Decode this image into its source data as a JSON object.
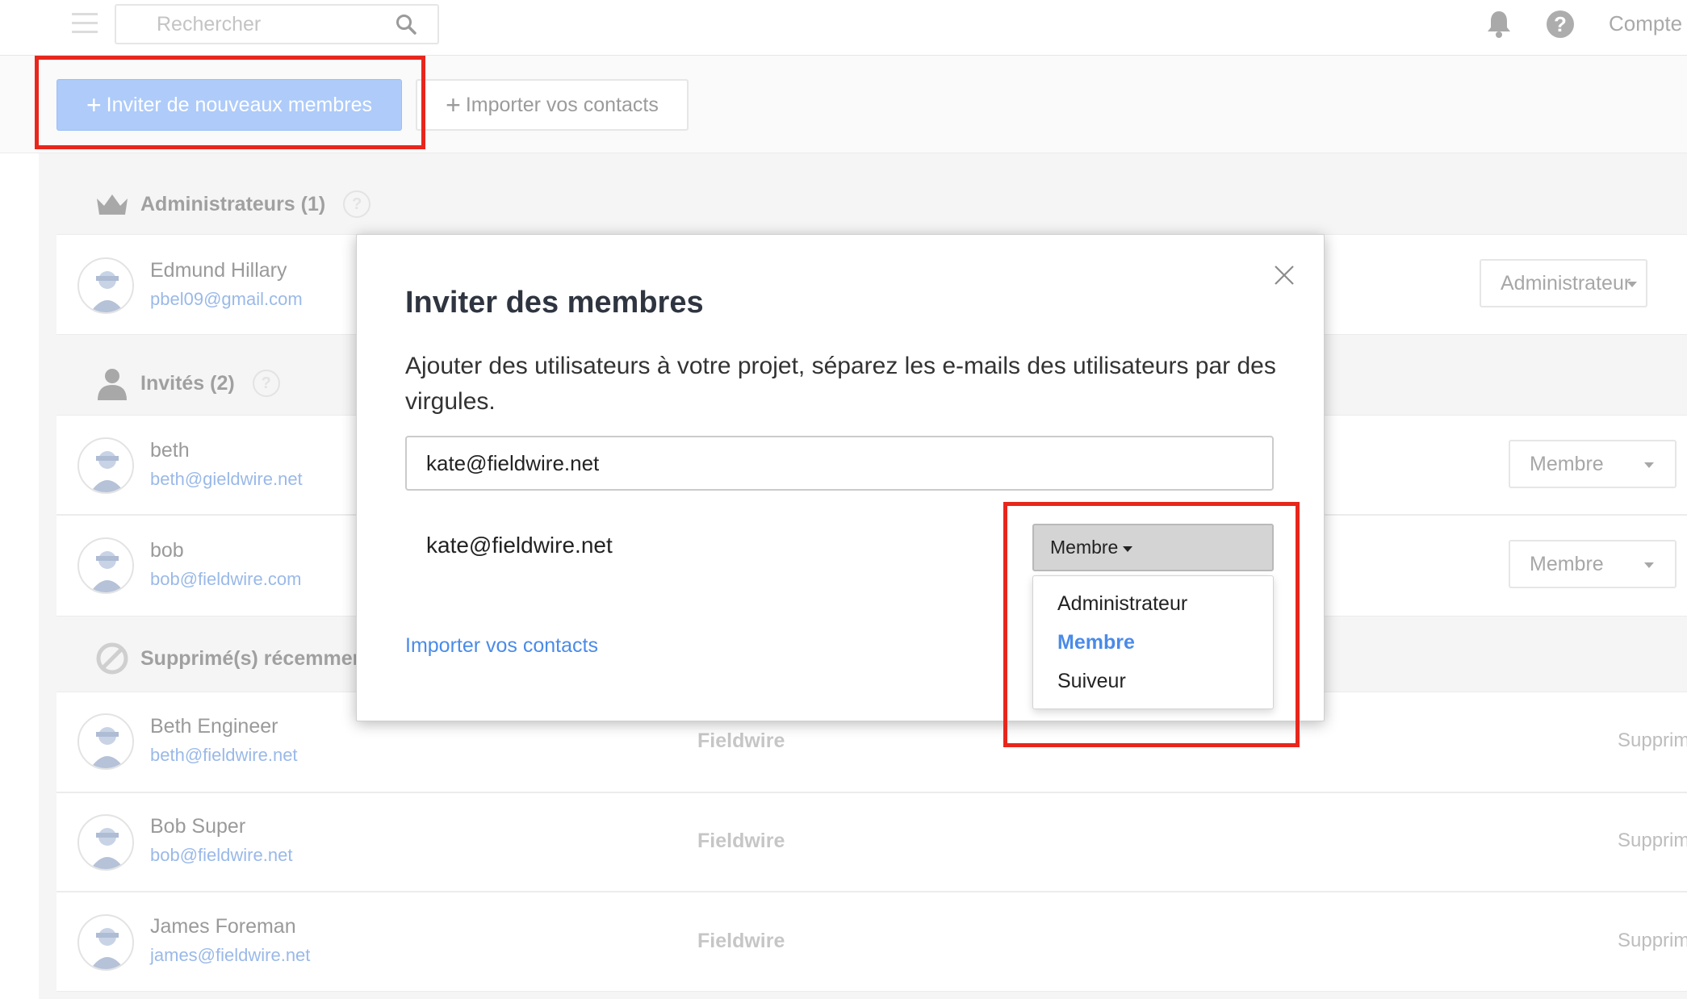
{
  "header": {
    "search_placeholder": "Rechercher",
    "account_label": "Compte"
  },
  "toolbar": {
    "invite_label": "Inviter de nouveaux membres",
    "import_label": "Importer vos contacts",
    "plus_glyph": "+"
  },
  "sections": {
    "admins": {
      "label": "Administrateurs (1)"
    },
    "invited": {
      "label": "Invités (2)"
    },
    "removed": {
      "label": "Supprimé(s) récemment"
    }
  },
  "admins": [
    {
      "name": "Edmund Hillary",
      "email": "pbel09@gmail.com",
      "role": "Administrateur"
    }
  ],
  "invited": [
    {
      "name": "beth",
      "email": "beth@gieldwire.net",
      "role": "Membre"
    },
    {
      "name": "bob",
      "email": "bob@fieldwire.com",
      "role": "Membre"
    }
  ],
  "removed": [
    {
      "name": "Beth Engineer",
      "email": "beth@fieldwire.net",
      "company": "Fieldwire",
      "status": "Supprim"
    },
    {
      "name": "Bob Super",
      "email": "bob@fieldwire.net",
      "company": "Fieldwire",
      "status": "Supprim"
    },
    {
      "name": "James Foreman",
      "email": "james@fieldwire.net",
      "company": "Fieldwire",
      "status": "Supprim"
    }
  ],
  "modal": {
    "title": "Inviter des membres",
    "description": "Ajouter des utilisateurs à votre projet, séparez les e-mails des utilisateurs par des virgules.",
    "email_input_value": "kate@fieldwire.net",
    "pending_email": "kate@fieldwire.net",
    "role_selected": "Membre",
    "role_options": [
      "Administrateur",
      "Membre",
      "Suiveur"
    ],
    "import_link": "Importer vos contacts"
  },
  "colors": {
    "accent": "#4a8be8",
    "highlight": "#e8261c",
    "invite_button": "#aecbf9"
  }
}
